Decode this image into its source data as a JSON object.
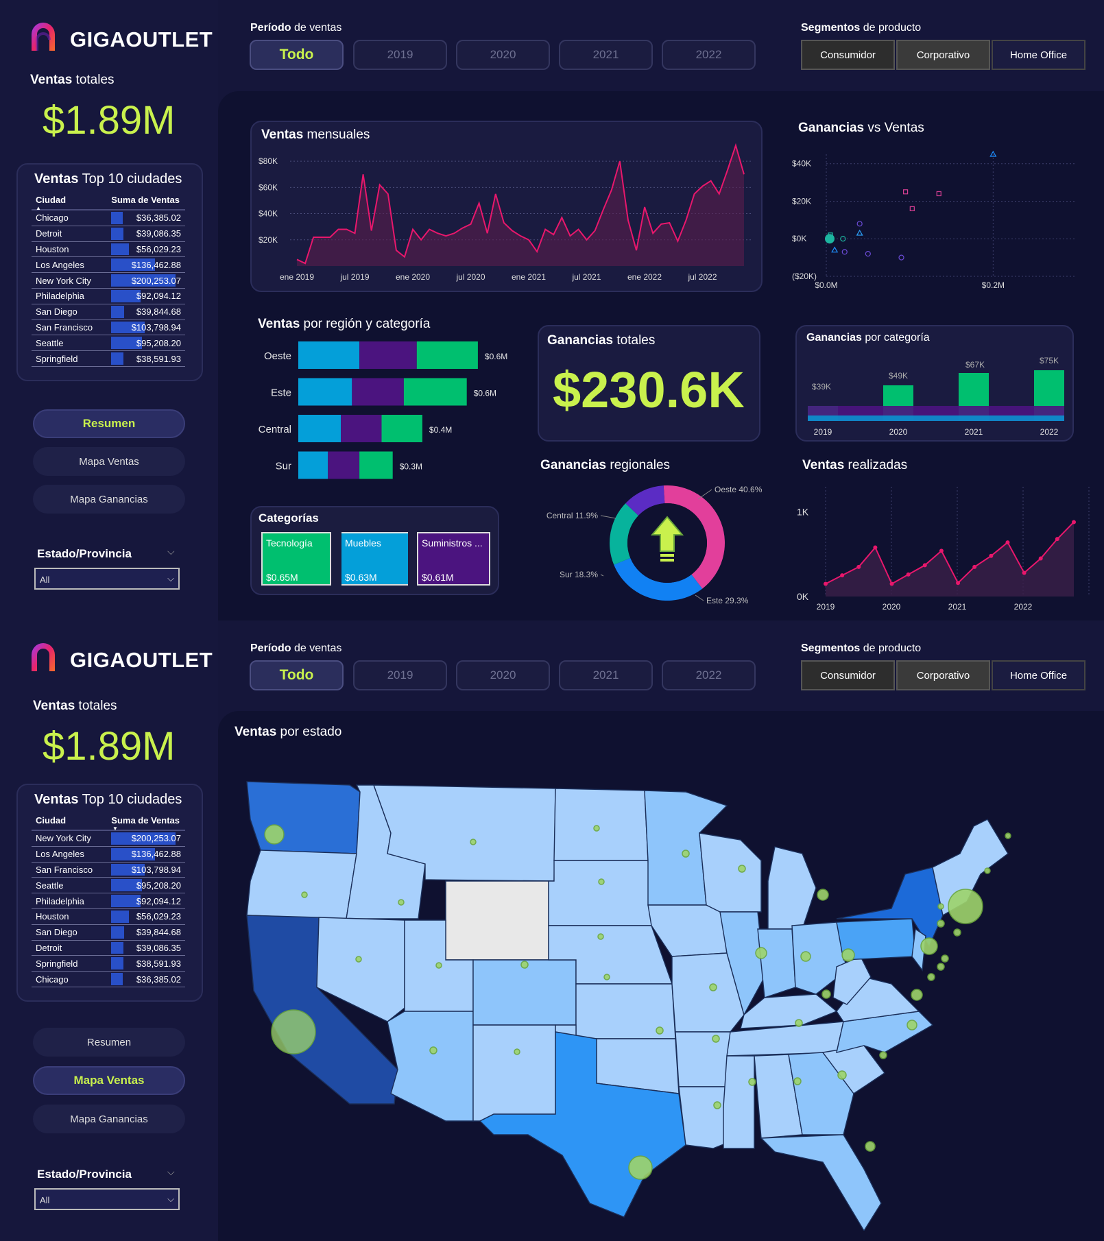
{
  "brand": "GIGAOUTLET",
  "colors": {
    "accent": "#c9f14d",
    "pink": "#e8176c",
    "teal": "#00bf6f",
    "blue": "#049fd9",
    "purple": "#4b147f"
  },
  "filters": {
    "period_bold": "Período",
    "period_rest": " de ventas",
    "years": [
      "Todo",
      "2019",
      "2020",
      "2021",
      "2022"
    ],
    "segment_bold": "Segmentos",
    "segment_rest": " de producto",
    "segments": [
      "Consumidor",
      "Corporativo",
      "Home Office"
    ]
  },
  "sidebar": {
    "total_bold": "Ventas",
    "total_rest": " totales",
    "total_value": "$1.89M",
    "top_bold": "Ventas",
    "top_rest": " Top 10 ciudades",
    "col_city": "Ciudad",
    "col_sum": "Suma de Ventas",
    "nav": [
      "Resumen",
      "Mapa Ventas",
      "Mapa Ganancias"
    ],
    "state_label": "Estado/Provincia",
    "state_value": "All"
  },
  "page1": {
    "cities": [
      {
        "city": "Chicago",
        "value": "$36,385.02",
        "fill": 0.18
      },
      {
        "city": "Detroit",
        "value": "$39,086.35",
        "fill": 0.195
      },
      {
        "city": "Houston",
        "value": "$56,029.23",
        "fill": 0.28
      },
      {
        "city": "Los Angeles",
        "value": "$136,462.88",
        "fill": 0.68
      },
      {
        "city": "New York City",
        "value": "$200,253.07",
        "fill": 1.0
      },
      {
        "city": "Philadelphia",
        "value": "$92,094.12",
        "fill": 0.46
      },
      {
        "city": "San Diego",
        "value": "$39,844.68",
        "fill": 0.2
      },
      {
        "city": "San Francisco",
        "value": "$103,798.94",
        "fill": 0.52
      },
      {
        "city": "Seattle",
        "value": "$95,208.20",
        "fill": 0.475
      },
      {
        "city": "Springfield",
        "value": "$38,591.93",
        "fill": 0.19
      }
    ],
    "monthly": {
      "title_bold": "Ventas",
      "title_rest": " mensuales",
      "y_ticks": [
        "$80K",
        "$60K",
        "$40K",
        "$20K"
      ],
      "x_ticks": [
        "ene 2019",
        "jul 2019",
        "ene 2020",
        "jul 2020",
        "ene 2021",
        "jul 2021",
        "ene 2022",
        "jul 2022"
      ]
    },
    "scatter": {
      "title_bold": "Ganancias",
      "title_rest": " vs Ventas",
      "y_ticks": [
        "$40K",
        "$20K",
        "$0K",
        "($20K)"
      ],
      "x_ticks": [
        "$0.0M",
        "$0.2M"
      ]
    },
    "region": {
      "title_bold": "Ventas",
      "title_rest": " por región y categoría",
      "rows": [
        {
          "name": "Oeste",
          "total": "$0.6M",
          "segs": [
            0.33,
            0.31,
            0.33
          ]
        },
        {
          "name": "Este",
          "total": "$0.6M",
          "segs": [
            0.29,
            0.28,
            0.34
          ]
        },
        {
          "name": "Central",
          "total": "$0.4M",
          "segs": [
            0.23,
            0.22,
            0.22
          ]
        },
        {
          "name": "Sur",
          "total": "$0.3M",
          "segs": [
            0.16,
            0.17,
            0.18
          ]
        }
      ]
    },
    "categories": {
      "title": "Categorías",
      "items": [
        {
          "name": "Tecnología",
          "value": "$0.65M"
        },
        {
          "name": "Muebles",
          "value": "$0.63M"
        },
        {
          "name": "Suministros ...",
          "value": "$0.61M"
        }
      ]
    },
    "profit_total": {
      "title_bold": "Ganancias",
      "title_rest": " totales",
      "value": "$230.6K"
    },
    "profit_cat": {
      "title_bold": "Ganancias",
      "title_rest": " por categoría",
      "years": [
        "2019",
        "2020",
        "2021",
        "2022"
      ],
      "values": [
        "$39K",
        "$49K",
        "$67K",
        "$75K"
      ]
    },
    "profit_region": {
      "title_bold": "Ganancias",
      "title_rest": " regionales",
      "slices": [
        {
          "name": "Oeste",
          "pct": "40.6%",
          "label": "Oeste 40.6%"
        },
        {
          "name": "Este",
          "pct": "29.3%",
          "label": "Este 29.3%"
        },
        {
          "name": "Sur",
          "pct": "18.3%",
          "label": "Sur 18.3%"
        },
        {
          "name": "Central",
          "pct": "11.9%",
          "label": "Central 11.9%"
        }
      ]
    },
    "orders": {
      "title_bold": "Ventas",
      "title_rest": " realizadas",
      "y_ticks": [
        "1K",
        "0K"
      ],
      "x_ticks": [
        "2019",
        "2020",
        "2021",
        "2022"
      ]
    }
  },
  "page2": {
    "cities": [
      {
        "city": "New York City",
        "value": "$200,253.07",
        "fill": 1.0
      },
      {
        "city": "Los Angeles",
        "value": "$136,462.88",
        "fill": 0.68
      },
      {
        "city": "San Francisco",
        "value": "$103,798.94",
        "fill": 0.52
      },
      {
        "city": "Seattle",
        "value": "$95,208.20",
        "fill": 0.475
      },
      {
        "city": "Philadelphia",
        "value": "$92,094.12",
        "fill": 0.46
      },
      {
        "city": "Houston",
        "value": "$56,029.23",
        "fill": 0.28
      },
      {
        "city": "San Diego",
        "value": "$39,844.68",
        "fill": 0.2
      },
      {
        "city": "Detroit",
        "value": "$39,086.35",
        "fill": 0.195
      },
      {
        "city": "Springfield",
        "value": "$38,591.93",
        "fill": 0.19
      },
      {
        "city": "Chicago",
        "value": "$36,385.02",
        "fill": 0.18
      }
    ],
    "map_title_bold": "Ventas",
    "map_title_rest": " por estado"
  },
  "chart_data": [
    {
      "type": "area",
      "title": "Ventas mensuales",
      "x_range": [
        "ene 2019",
        "dic 2022"
      ],
      "ylim": [
        0,
        90000
      ],
      "values": [
        5000,
        2000,
        22000,
        22000,
        22000,
        28000,
        28000,
        25000,
        70000,
        27000,
        62000,
        55000,
        12000,
        7000,
        28000,
        20000,
        28000,
        25000,
        23000,
        25000,
        29000,
        32000,
        48000,
        25000,
        55000,
        33000,
        27000,
        23000,
        20000,
        11000,
        28000,
        24000,
        37000,
        23000,
        28000,
        20000,
        27000,
        43000,
        58000,
        80000,
        35000,
        12000,
        45000,
        25000,
        32000,
        33000,
        19000,
        35000,
        55000,
        61000,
        65000,
        55000,
        73000,
        92000,
        70000
      ]
    },
    {
      "type": "scatter",
      "title": "Ganancias vs Ventas",
      "xlim": [
        0,
        0.3
      ],
      "ylim": [
        -20000,
        45000
      ],
      "points": [
        [
          0.2,
          45000
        ],
        [
          0.095,
          25000
        ],
        [
          0.135,
          24000
        ],
        [
          0.103,
          16000
        ],
        [
          0.04,
          8000
        ],
        [
          0.04,
          3000
        ],
        [
          0.02,
          0
        ],
        [
          0.01,
          -6000
        ],
        [
          0.022,
          -7000
        ],
        [
          0.05,
          -8000
        ],
        [
          0.09,
          -10000
        ],
        [
          0.005,
          2000
        ]
      ]
    },
    {
      "type": "bar",
      "title": "Ventas por región y categoría",
      "categories": [
        "Oeste",
        "Este",
        "Central",
        "Sur"
      ],
      "series": [
        {
          "name": "Tecnología",
          "values": [
            0.19,
            0.18,
            0.13,
            0.1
          ]
        },
        {
          "name": "Muebles",
          "values": [
            0.18,
            0.16,
            0.12,
            0.1
          ]
        },
        {
          "name": "Suministros",
          "values": [
            0.19,
            0.19,
            0.13,
            0.11
          ]
        }
      ]
    },
    {
      "type": "pie",
      "title": "Ganancias regionales",
      "categories": [
        "Oeste",
        "Este",
        "Sur",
        "Central"
      ],
      "values": [
        40.6,
        29.3,
        18.3,
        11.9
      ]
    },
    {
      "type": "line",
      "title": "Ventas realizadas",
      "ylim": [
        0,
        1200
      ],
      "values": [
        150,
        250,
        350,
        580,
        150,
        260,
        370,
        540,
        160,
        350,
        480,
        640,
        280,
        450,
        680,
        880
      ]
    },
    {
      "type": "area",
      "title": "Ganancias por categoría",
      "categories": [
        "2019",
        "2020",
        "2021",
        "2022"
      ],
      "values": [
        39,
        49,
        67,
        75
      ]
    }
  ]
}
